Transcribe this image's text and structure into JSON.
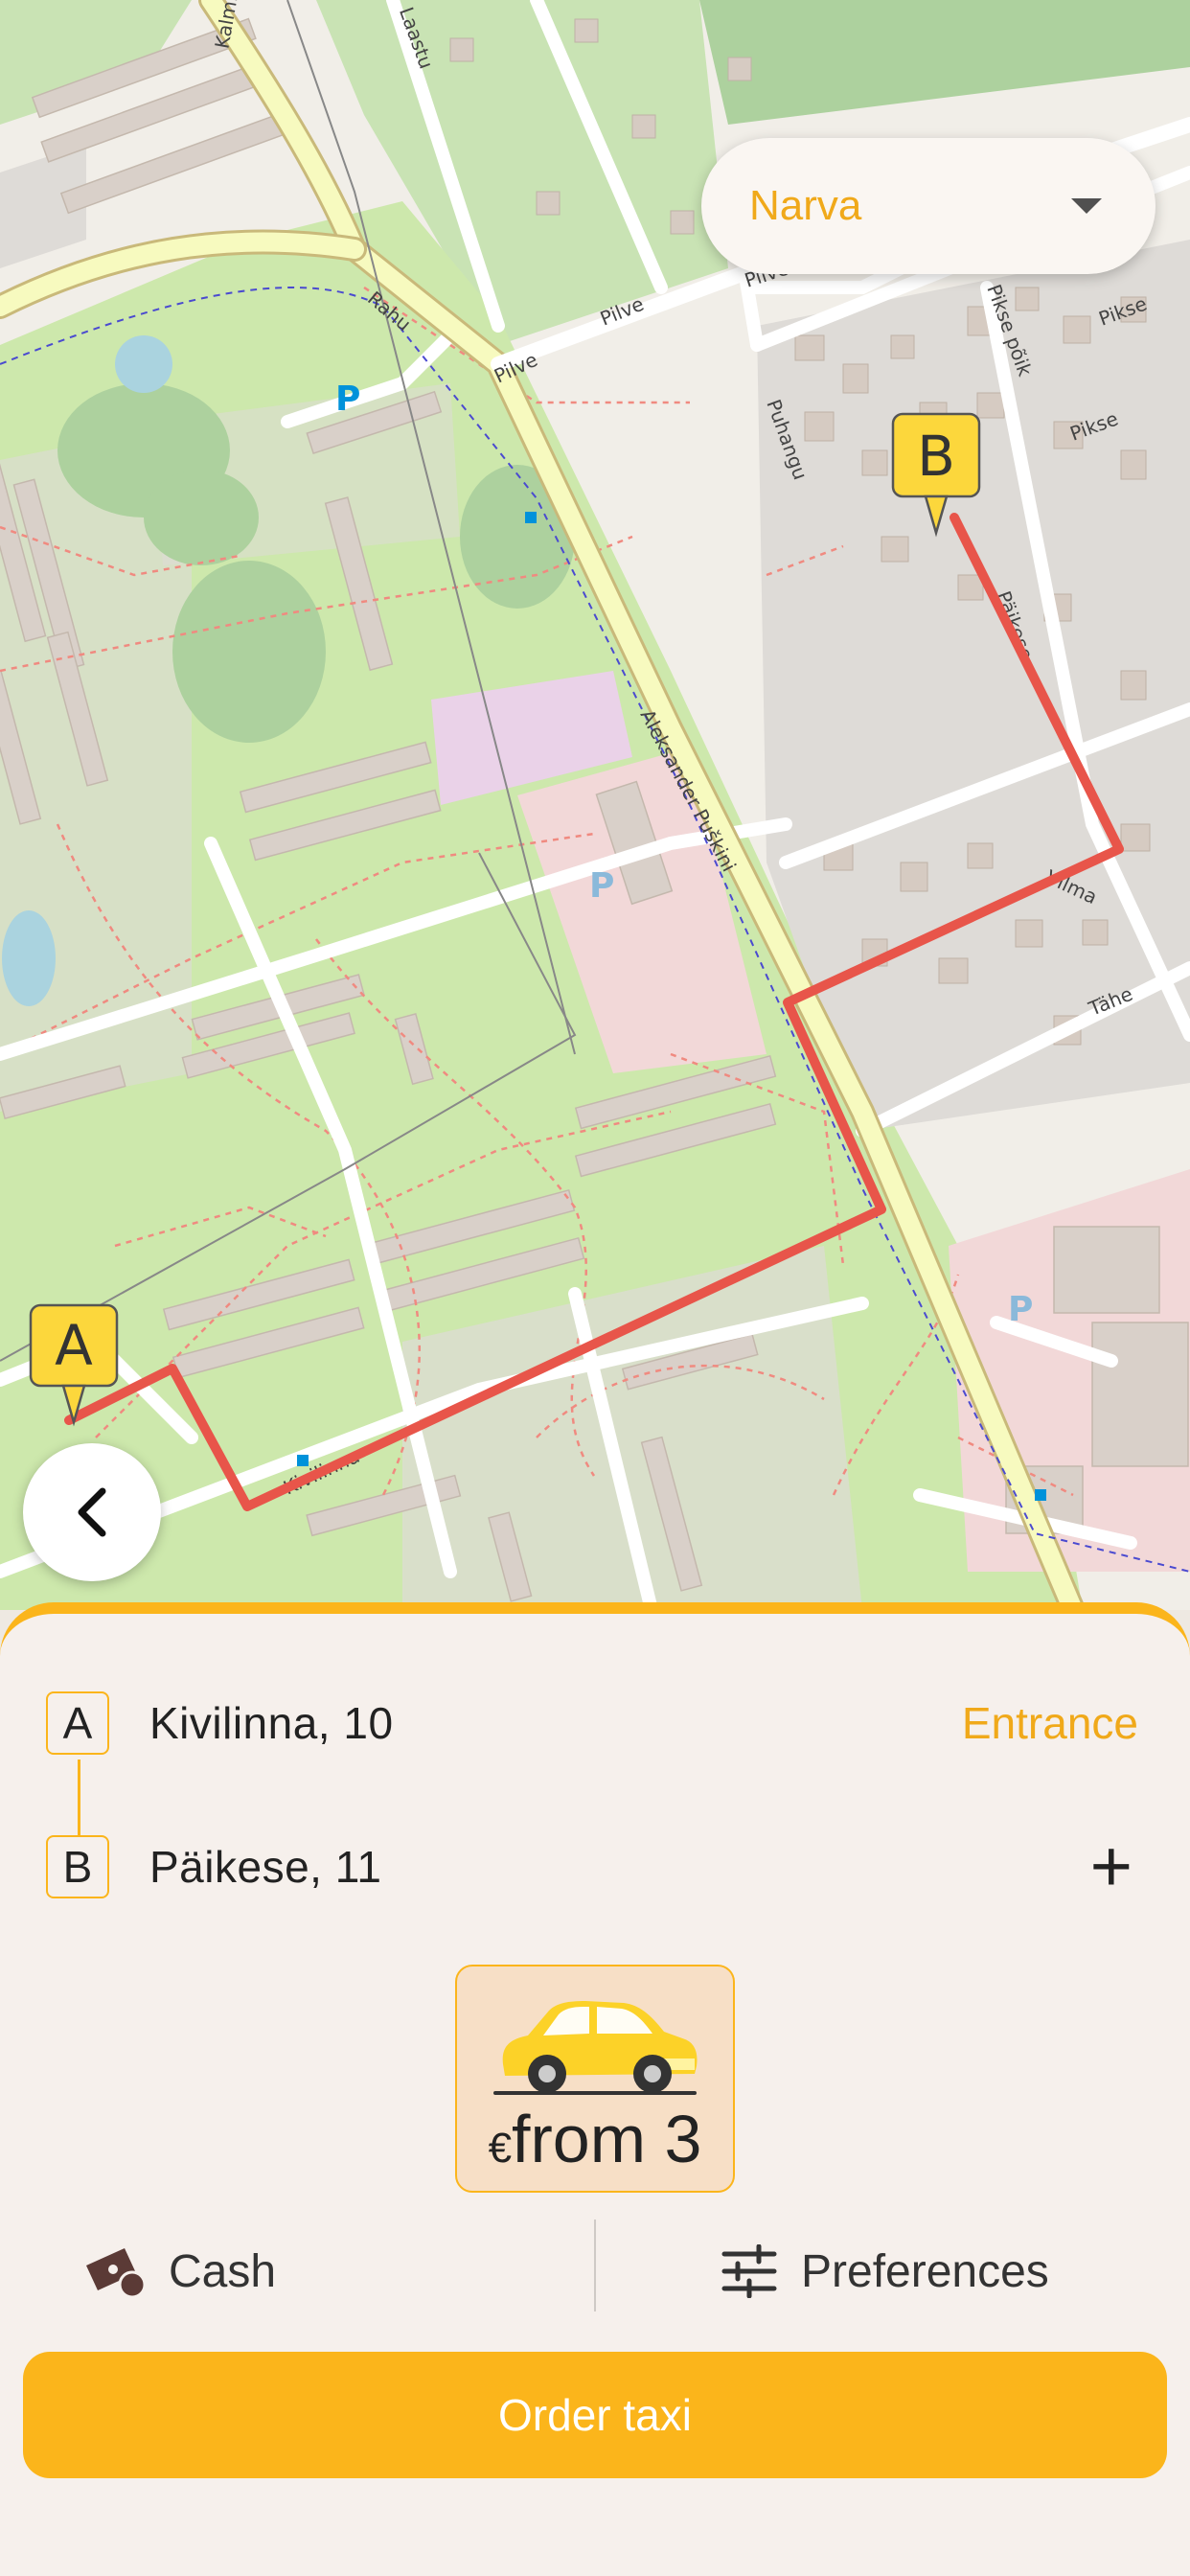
{
  "city_select": {
    "value": "Narva"
  },
  "map": {
    "streets": [
      "Kalmistu",
      "Laastu",
      "Rahu",
      "Pilve",
      "Pilve",
      "Pilve",
      "Puhangu",
      "Pikse põik",
      "Pikse",
      "Pikse",
      "Päikese",
      "Aleksander Puškini",
      "Vilma",
      "Tähe",
      "Kivilinna"
    ],
    "parking": "P",
    "marker_a": "A",
    "marker_b": "B",
    "route_color": "#e8554a"
  },
  "route": {
    "from": {
      "badge": "A",
      "address": "Kivilinna, 10",
      "action": "Entrance"
    },
    "to": {
      "badge": "B",
      "address": "Päikese, 11",
      "action_icon": "plus-icon"
    }
  },
  "tariff": {
    "currency": "€",
    "price": "from 3",
    "icon": "car-icon"
  },
  "options": {
    "payment": "Cash",
    "payment_icon": "cash-icon",
    "preferences": "Preferences",
    "preferences_icon": "sliders-icon"
  },
  "order_button": {
    "label": "Order taxi"
  },
  "colors": {
    "accent": "#fbb51b",
    "accent_text": "#f0a91a",
    "park": "#cde8ac",
    "building": "#dcd0c6"
  }
}
